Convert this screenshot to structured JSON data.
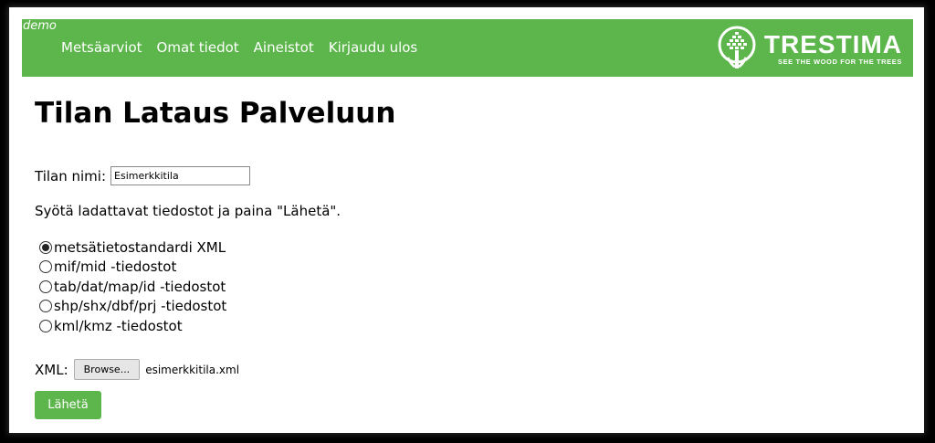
{
  "header": {
    "demo_label": "demo",
    "nav": [
      "Metsäarviot",
      "Omat tiedot",
      "Aineistot",
      "Kirjaudu ulos"
    ],
    "logo": {
      "name": "TRESTIMA",
      "tagline": "SEE THE WOOD FOR THE TREES"
    },
    "brand_color": "#5cb64b"
  },
  "page_title": "Tilan Lataus Palveluun",
  "farm_name": {
    "label": "Tilan nimi:",
    "value": "Esimerkkitila"
  },
  "instructions": "Syötä ladattavat tiedostot ja paina \"Lähetä\".",
  "format_options": [
    {
      "label": "metsätietostandardi XML",
      "checked": true
    },
    {
      "label": "mif/mid -tiedostot",
      "checked": false
    },
    {
      "label": "tab/dat/map/id -tiedostot",
      "checked": false
    },
    {
      "label": "shp/shx/dbf/prj -tiedostot",
      "checked": false
    },
    {
      "label": "kml/kmz -tiedostot",
      "checked": false
    }
  ],
  "file_input": {
    "label": "XML:",
    "button": "Browse...",
    "filename": "esimerkkitila.xml"
  },
  "submit_label": "Lähetä"
}
